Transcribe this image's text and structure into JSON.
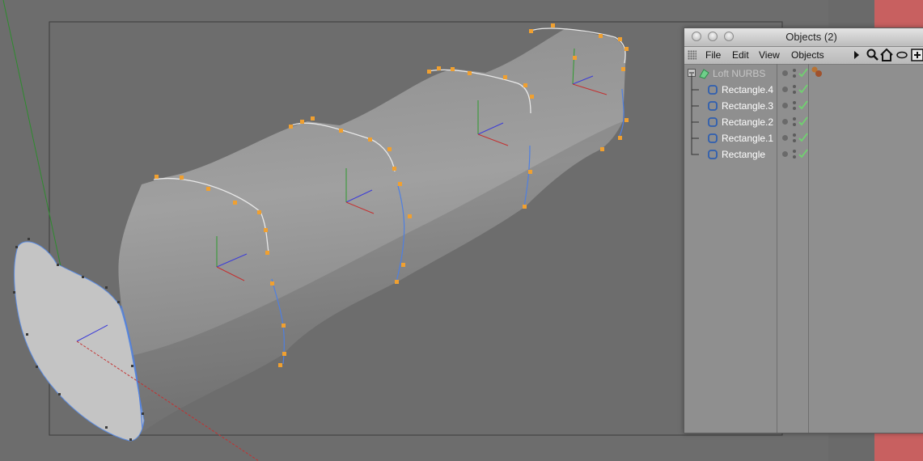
{
  "window": {
    "title": "Objects (2)",
    "controls": [
      "close-button",
      "minimize-button",
      "zoom-button"
    ]
  },
  "menu": {
    "items": [
      "File",
      "Edit",
      "View",
      "Objects"
    ]
  },
  "toolbar": {
    "icons": [
      "expand-arrow-icon",
      "search-icon",
      "home-icon",
      "eye-icon",
      "new-object-icon"
    ]
  },
  "objects": [
    {
      "name": "Loft NURBS",
      "type": "loft-nurbs",
      "level": 0,
      "tag": "material-tag"
    },
    {
      "name": "Rectangle.4",
      "type": "spline",
      "level": 1
    },
    {
      "name": "Rectangle.3",
      "type": "spline",
      "level": 1
    },
    {
      "name": "Rectangle.2",
      "type": "spline",
      "level": 1
    },
    {
      "name": "Rectangle.1",
      "type": "spline",
      "level": 1
    },
    {
      "name": "Rectangle",
      "type": "spline",
      "level": 1
    }
  ],
  "colors": {
    "viewport_bg": "#6d6d6d",
    "model_gray": "#9a9a9a",
    "spline_points": "#f0a030",
    "panel_bg": "#8f8f8f",
    "accent_strip": "#c86060",
    "check_green": "#6fd36f"
  }
}
